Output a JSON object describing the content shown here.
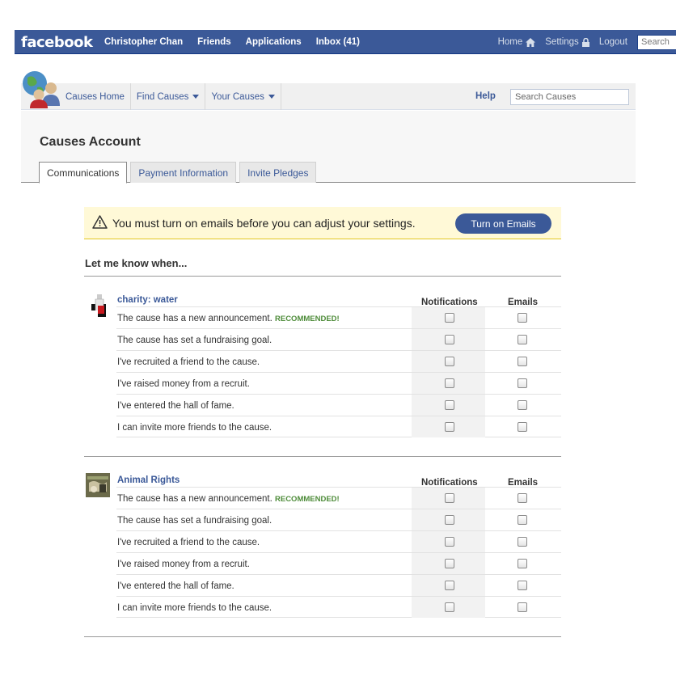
{
  "topbar": {
    "logo": "facebook",
    "nav": [
      "Christopher Chan",
      "Friends",
      "Applications",
      "Inbox (41)"
    ],
    "home": "Home",
    "settings": "Settings",
    "logout": "Logout",
    "search_placeholder": "Search",
    "color": "#3b5998"
  },
  "app": {
    "nav": {
      "home": "Causes Home",
      "find": "Find Causes",
      "yours": "Your Causes"
    },
    "help": "Help",
    "search_placeholder": "Search Causes"
  },
  "account": {
    "title": "Causes Account",
    "tabs": [
      "Communications",
      "Payment Information",
      "Invite Pledges"
    ],
    "active_tab": "Communications"
  },
  "warning": {
    "text": "You must turn on emails before you can adjust your settings.",
    "button": "Turn on Emails"
  },
  "section_title": "Let me know when...",
  "columns": {
    "notifications": "Notifications",
    "emails": "Emails"
  },
  "recommended_label": "RECOMMENDED!",
  "causes": [
    {
      "name": "charity: water",
      "rows": [
        "The cause has a new announcement.",
        "The cause has set a fundraising goal.",
        "I've recruited a friend to the cause.",
        "I've raised money from a recruit.",
        "I've entered the hall of fame.",
        "I can invite more friends to the cause."
      ]
    },
    {
      "name": "Animal Rights",
      "rows": [
        "The cause has a new announcement.",
        "The cause has set a fundraising goal.",
        "I've recruited a friend to the cause.",
        "I've raised money from a recruit.",
        "I've entered the hall of fame.",
        "I can invite more friends to the cause."
      ]
    }
  ]
}
